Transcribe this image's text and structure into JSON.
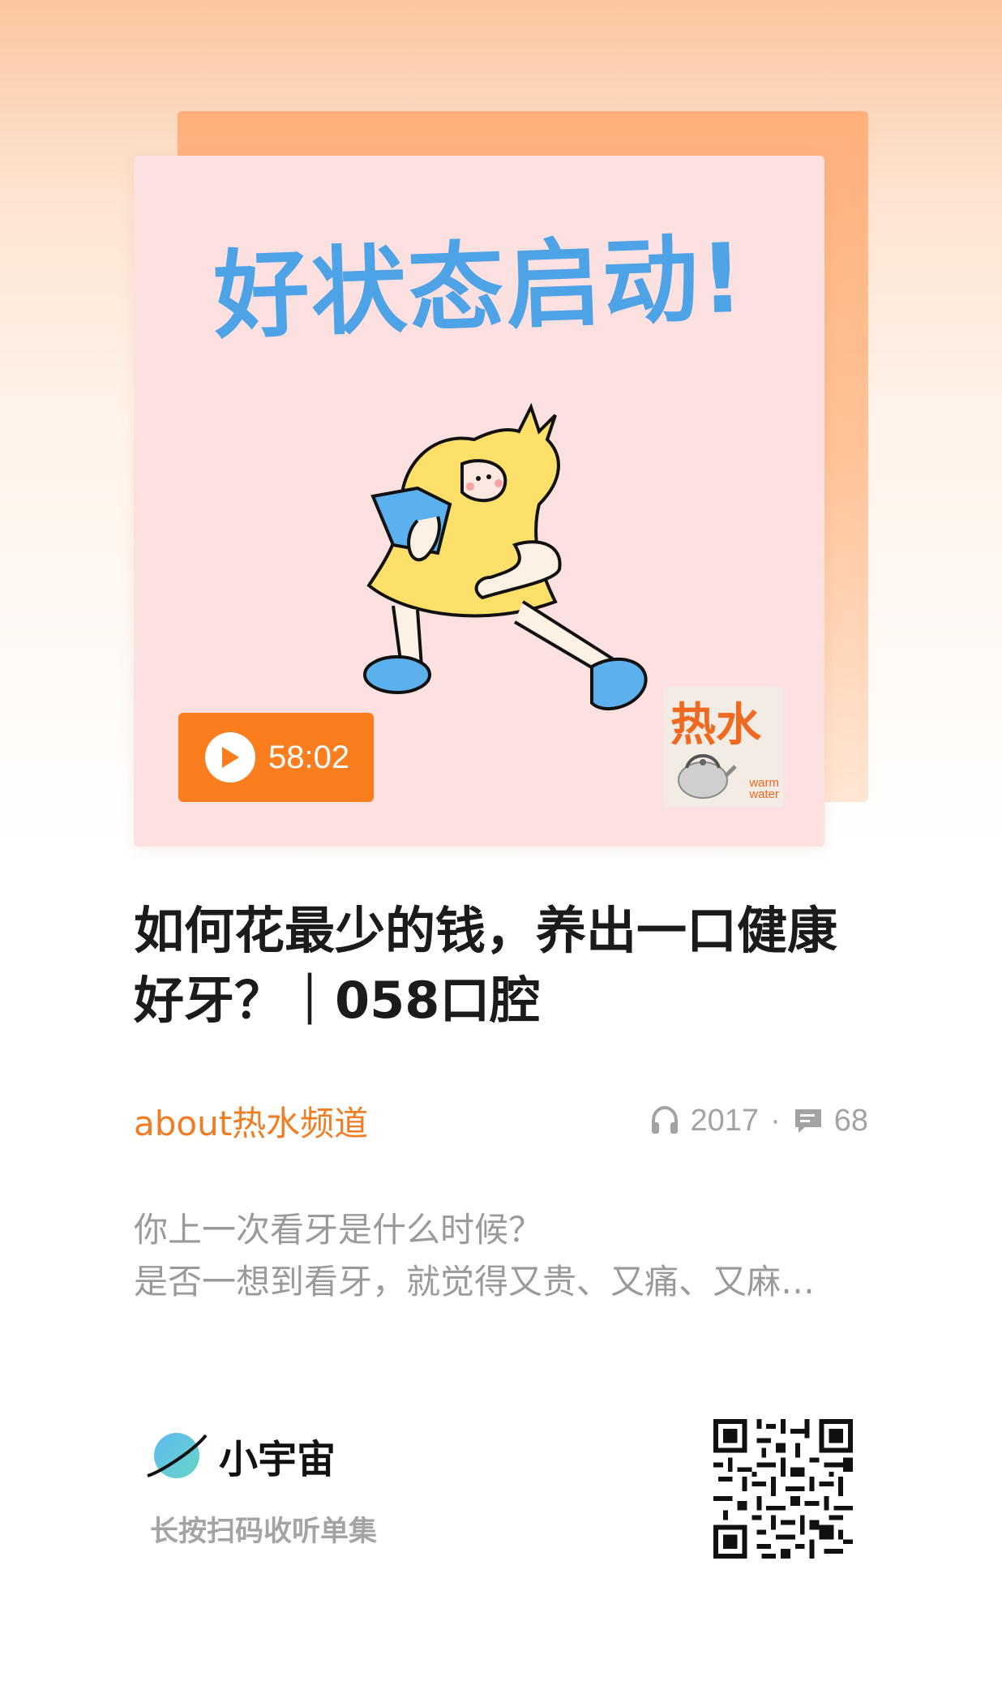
{
  "cover": {
    "title": "好状态启动!",
    "duration": "58:02",
    "logo_text": "热水",
    "logo_sub_line1": "warm",
    "logo_sub_line2": "water"
  },
  "episode": {
    "title": "如何花最少的钱，养出一口健康好牙？｜058口腔",
    "channel": "about热水频道",
    "plays": "2017",
    "separator": "·",
    "comments": "68",
    "description_lines": [
      "你上一次看牙是什么时候？",
      "是否一想到看牙，就觉得又贵、又痛、又麻…"
    ]
  },
  "footer": {
    "brand": "小宇宙",
    "scan_hint": "长按扫码收听单集"
  },
  "colors": {
    "accent": "#fa7d1e",
    "channel": "#f07d24",
    "cover_bg": "#fde1e0",
    "cover_title": "#4ea3e6"
  },
  "icons": [
    "play-icon",
    "headphones-icon",
    "comment-icon",
    "planet-logo-icon",
    "qr-code"
  ]
}
